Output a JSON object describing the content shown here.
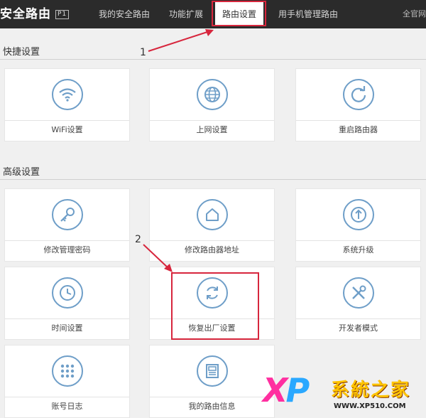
{
  "header": {
    "brand": "安全路由",
    "brand_badge": "P1",
    "nav": [
      {
        "label": "我的安全路由"
      },
      {
        "label": "功能扩展"
      },
      {
        "label": "路由设置"
      },
      {
        "label": "用手机管理路由"
      }
    ],
    "right_text": "全官网"
  },
  "quick": {
    "title": "快捷设置",
    "items": [
      {
        "label": "WiFi设置",
        "icon": "wifi-icon"
      },
      {
        "label": "上网设置",
        "icon": "globe-icon"
      },
      {
        "label": "重启路由器",
        "icon": "restart-icon"
      }
    ]
  },
  "advanced": {
    "title": "高级设置",
    "items": [
      {
        "label": "修改管理密码",
        "icon": "key-icon"
      },
      {
        "label": "修改路由器地址",
        "icon": "home-icon"
      },
      {
        "label": "系统升级",
        "icon": "upgrade-icon"
      },
      {
        "label": "时间设置",
        "icon": "clock-icon"
      },
      {
        "label": "恢复出厂设置",
        "icon": "factory-reset-icon"
      },
      {
        "label": "开发者模式",
        "icon": "tools-icon"
      },
      {
        "label": "账号日志",
        "icon": "grid-icon"
      },
      {
        "label": "我的路由信息",
        "icon": "info-card-icon"
      }
    ]
  },
  "annotations": {
    "step1": "1",
    "step2": "2",
    "color": "#d7263d"
  },
  "watermark": {
    "xp_x": "X",
    "xp_p": "P",
    "name": "系統之家",
    "url": "WWW.XP510.COM"
  },
  "colors": {
    "topbar": "#2b2b2b",
    "icon_stroke": "#6e9ec8",
    "background": "#f0f0f0"
  }
}
